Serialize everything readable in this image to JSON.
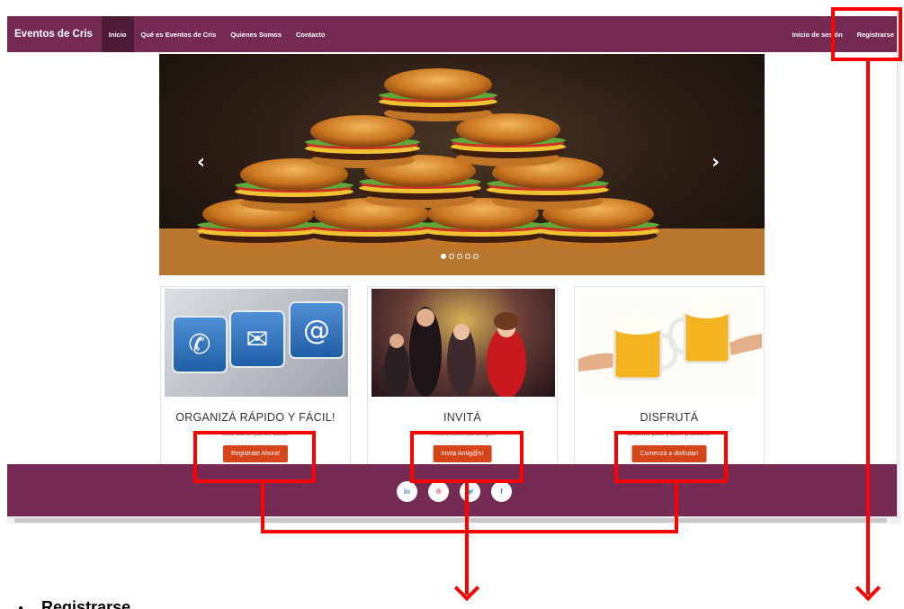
{
  "navbar": {
    "brand": "Eventos de Cris",
    "links": [
      "Inicio",
      "Qué es Eventos de Cris",
      "Quienes Somos",
      "Contacto"
    ],
    "right_links": [
      "Inicio de sesión",
      "Registrarse"
    ]
  },
  "carousel": {
    "prev_icon": "‹",
    "next_icon": "›",
    "slide_count": 5,
    "active_slide": 1
  },
  "cards": [
    {
      "title": "ORGANIZÁ RÁPIDO Y FÁCIL!",
      "text": "Solo con un par de clicks!",
      "button": "Registrate Ahora!"
    },
    {
      "title": "INVITÁ",
      "text": "Invitá a todos tus amigos",
      "button": "Invita Amig@s!"
    },
    {
      "title": "DISFRUTÁ",
      "text": "El último paso y buen provecho!",
      "button": "Comenzá a disfrutar!"
    }
  ],
  "key_icons": [
    "✆",
    "✉",
    "@"
  ],
  "footer": {
    "social": [
      {
        "icon": "linkedin-icon",
        "label": "in"
      },
      {
        "icon": "pinterest-icon",
        "label": "℗"
      },
      {
        "icon": "twitter-icon",
        "label": "🐦"
      },
      {
        "icon": "facebook-icon",
        "label": "f"
      }
    ]
  },
  "annotation": {
    "bullet_text": "Registrarse",
    "color": "#ff0000"
  },
  "colors": {
    "brand": "#742a52",
    "button": "#d64419"
  }
}
